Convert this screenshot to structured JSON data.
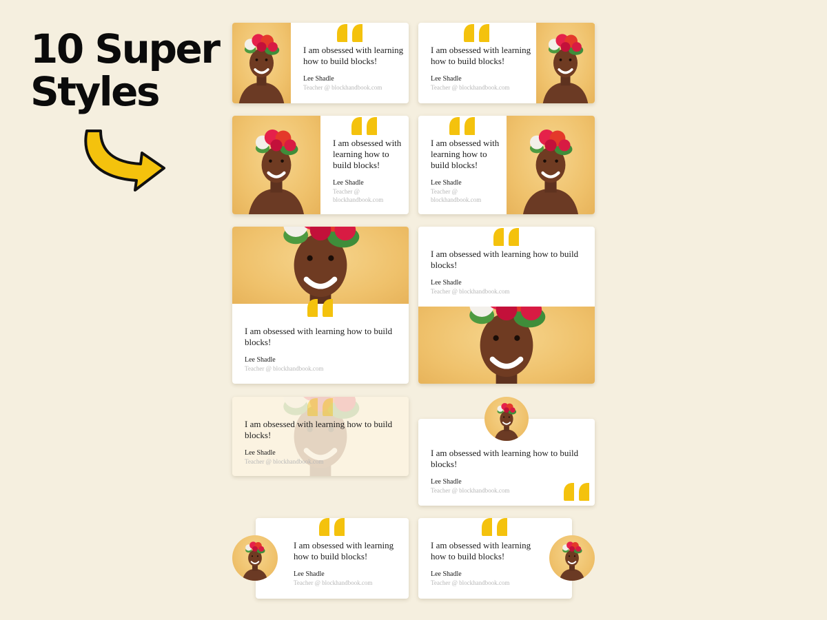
{
  "headline": {
    "line1": "10 Super",
    "line2": "Styles"
  },
  "testimonial": {
    "quote": "I am obsessed with learning how to build blocks!",
    "author": "Lee Shadle",
    "role": "Teacher @ blockhandbook.com"
  },
  "cards": [
    {
      "style": "image-left-small"
    },
    {
      "style": "image-right-small"
    },
    {
      "style": "image-left-half"
    },
    {
      "style": "image-right-half"
    },
    {
      "style": "image-top"
    },
    {
      "style": "image-bottom"
    },
    {
      "style": "image-background-faded"
    },
    {
      "style": "avatar-top-center"
    },
    {
      "style": "avatar-left"
    },
    {
      "style": "avatar-right"
    }
  ],
  "colors": {
    "background": "#f5efdf",
    "quote_mark": "#f4c20d",
    "arrow_fill": "#f4c20d",
    "photo_background": "#efc16b"
  },
  "icons": {
    "quote": "quote-mark-icon",
    "arrow": "curved-arrow-icon"
  }
}
